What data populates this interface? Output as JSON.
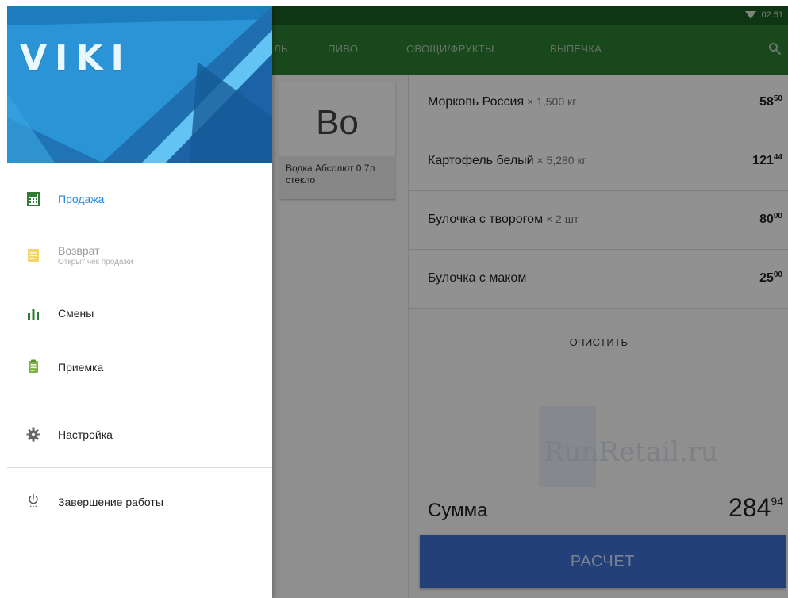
{
  "status_bar": {
    "time": "02:51"
  },
  "toolbar": {
    "tabs": [
      "ЛЬ",
      "ПИВО",
      "ОВОЩИ/ФРУКТЫ",
      "ВЫПЕЧКА"
    ]
  },
  "products": [
    {
      "abbr": "Во",
      "name": "Водка Абсолют 0,7л стекло"
    }
  ],
  "cart": {
    "items": [
      {
        "name": "Морковь Россия",
        "qty": " × 1,500 кг",
        "price_main": "58",
        "price_cents": "50"
      },
      {
        "name": "Картофель белый",
        "qty": " × 5,280 кг",
        "price_main": "121",
        "price_cents": "44"
      },
      {
        "name": "Булочка с творогом",
        "qty": " × 2 шт",
        "price_main": "80",
        "price_cents": "00"
      },
      {
        "name": "Булочка с маком",
        "qty": "",
        "price_main": "25",
        "price_cents": "00"
      }
    ],
    "clear_label": "ОЧИСТИТЬ",
    "watermark": "RunRetail.ru",
    "sum_label": "Сумма",
    "sum_main": "284",
    "sum_cents": "94",
    "pay_label": "РАСЧЕТ"
  },
  "drawer": {
    "logo": "VIKI",
    "items": [
      {
        "label": "Продажа",
        "sublabel": "",
        "icon": "calculator-icon",
        "color": "#1e88e5"
      },
      {
        "label": "Возврат",
        "sublabel": "Открыт чек продажи",
        "icon": "receipt-icon",
        "color": "#f5d36b"
      },
      {
        "label": "Смены",
        "sublabel": "",
        "icon": "bar-chart-icon",
        "color": "#2e7d32"
      },
      {
        "label": "Приемка",
        "sublabel": "",
        "icon": "clipboard-icon",
        "color": "#7cb342"
      },
      {
        "label": "Настройка",
        "sublabel": "",
        "icon": "gear-icon",
        "color": "#666666"
      },
      {
        "label": "Завершение работы",
        "sublabel": "",
        "icon": "power-icon",
        "color": "#666666"
      }
    ]
  }
}
